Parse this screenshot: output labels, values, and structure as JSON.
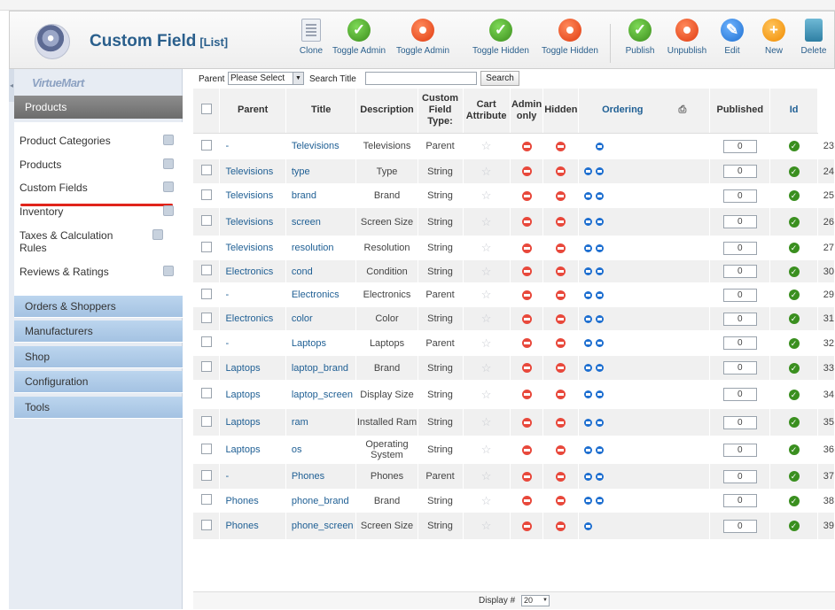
{
  "app": {
    "title": "Custom Field",
    "title_suffix": "[List]",
    "brand": "VirtueMart"
  },
  "toolbar": [
    {
      "label": "Clone",
      "icon": "clone-icon"
    },
    {
      "label": "Toggle Admin",
      "icon": "check-icon"
    },
    {
      "label": "Toggle Admin",
      "icon": "stop-icon"
    },
    {
      "label": "Toggle Hidden",
      "icon": "check-icon"
    },
    {
      "label": "Toggle Hidden",
      "icon": "stop-icon"
    },
    {
      "label": "Publish",
      "icon": "check-icon"
    },
    {
      "label": "Unpublish",
      "icon": "stop-icon"
    },
    {
      "label": "Edit",
      "icon": "edit-icon"
    },
    {
      "label": "New",
      "icon": "plus-icon"
    },
    {
      "label": "Delete",
      "icon": "trash-icon"
    }
  ],
  "sidebar": {
    "active_section": "Products",
    "items": [
      "Product Categories",
      "Products",
      "Custom Fields",
      "Inventory",
      "Taxes & Calculation Rules",
      "Reviews & Ratings"
    ],
    "sections": [
      "Orders & Shoppers",
      "Manufacturers",
      "Shop",
      "Configuration",
      "Tools"
    ]
  },
  "filter": {
    "parent_label": "Parent",
    "parent_value": "Please Select",
    "search_label": "Search Title",
    "search_value": "",
    "search_button": "Search"
  },
  "table": {
    "headers": {
      "parent": "Parent",
      "title": "Title",
      "description": "Description",
      "custom_field_type": "Custom Field Type:",
      "cart_attribute": "Cart Attribute",
      "admin_only": "Admin only",
      "hidden": "Hidden",
      "ordering": "Ordering",
      "published": "Published",
      "id": "Id"
    },
    "rows": [
      {
        "parent": "-",
        "title": "Televisions",
        "description": "Televisions",
        "type": "Parent",
        "ordering": "0",
        "id": "23",
        "up": false,
        "down": true
      },
      {
        "parent": "Televisions",
        "title": "type",
        "description": "Type",
        "type": "String",
        "ordering": "0",
        "id": "24",
        "up": true,
        "down": true
      },
      {
        "parent": "Televisions",
        "title": "brand",
        "description": "Brand",
        "type": "String",
        "ordering": "0",
        "id": "25",
        "up": true,
        "down": true
      },
      {
        "parent": "Televisions",
        "title": "screen",
        "description": "Screen Size",
        "type": "String",
        "ordering": "0",
        "id": "26",
        "up": true,
        "down": true
      },
      {
        "parent": "Televisions",
        "title": "resolution",
        "description": "Resolution",
        "type": "String",
        "ordering": "0",
        "id": "27",
        "up": true,
        "down": true
      },
      {
        "parent": "Electronics",
        "title": "cond",
        "description": "Condition",
        "type": "String",
        "ordering": "0",
        "id": "30",
        "up": true,
        "down": true
      },
      {
        "parent": "-",
        "title": "Electronics",
        "description": "Electronics",
        "type": "Parent",
        "ordering": "0",
        "id": "29",
        "up": true,
        "down": true
      },
      {
        "parent": "Electronics",
        "title": "color",
        "description": "Color",
        "type": "String",
        "ordering": "0",
        "id": "31",
        "up": true,
        "down": true
      },
      {
        "parent": "-",
        "title": "Laptops",
        "description": "Laptops",
        "type": "Parent",
        "ordering": "0",
        "id": "32",
        "up": true,
        "down": true
      },
      {
        "parent": "Laptops",
        "title": "laptop_brand",
        "description": "Brand",
        "type": "String",
        "ordering": "0",
        "id": "33",
        "up": true,
        "down": true
      },
      {
        "parent": "Laptops",
        "title": "laptop_screen",
        "description": "Display Size",
        "type": "String",
        "ordering": "0",
        "id": "34",
        "up": true,
        "down": true
      },
      {
        "parent": "Laptops",
        "title": "ram",
        "description": "Installed Ram",
        "type": "String",
        "ordering": "0",
        "id": "35",
        "up": true,
        "down": true
      },
      {
        "parent": "Laptops",
        "title": "os",
        "description": "Operating System",
        "type": "String",
        "ordering": "0",
        "id": "36",
        "up": true,
        "down": true
      },
      {
        "parent": "-",
        "title": "Phones",
        "description": "Phones",
        "type": "Parent",
        "ordering": "0",
        "id": "37",
        "up": true,
        "down": true
      },
      {
        "parent": "Phones",
        "title": "phone_brand",
        "description": "Brand",
        "type": "String",
        "ordering": "0",
        "id": "38",
        "up": true,
        "down": true
      },
      {
        "parent": "Phones",
        "title": "phone_screen",
        "description": "Screen Size",
        "type": "String",
        "ordering": "0",
        "id": "39",
        "up": true,
        "down": false
      }
    ]
  },
  "footer": {
    "display_label": "Display #",
    "display_value": "20"
  }
}
